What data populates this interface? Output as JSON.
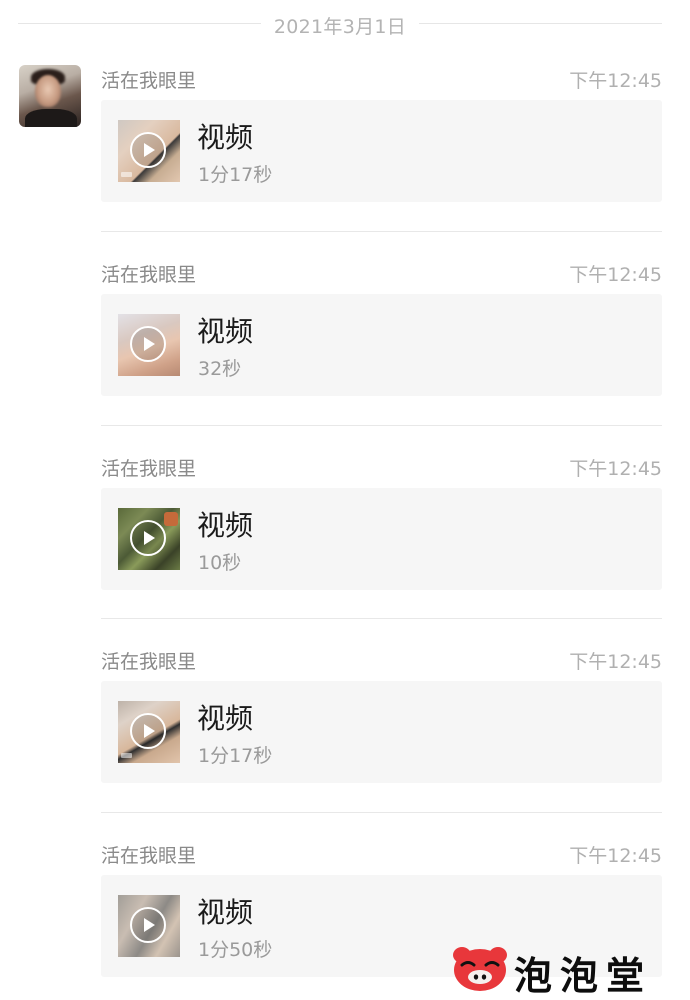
{
  "date_separator": "2021年3月1日",
  "colors": {
    "card_bg": "#f6f6f6",
    "muted_text": "#9a9a9a",
    "primary_text": "#1a1a1a",
    "watermark_red": "#e8373b"
  },
  "messages": [
    {
      "sender": "活在我眼里",
      "time": "下午12:45",
      "type_label": "视频",
      "duration": "1分17秒",
      "thumbnail": "video-thumbnail-1"
    },
    {
      "sender": "活在我眼里",
      "time": "下午12:45",
      "type_label": "视频",
      "duration": "32秒",
      "thumbnail": "video-thumbnail-2"
    },
    {
      "sender": "活在我眼里",
      "time": "下午12:45",
      "type_label": "视频",
      "duration": "10秒",
      "thumbnail": "video-thumbnail-3"
    },
    {
      "sender": "活在我眼里",
      "time": "下午12:45",
      "type_label": "视频",
      "duration": "1分17秒",
      "thumbnail": "video-thumbnail-4"
    },
    {
      "sender": "活在我眼里",
      "time": "下午12:45",
      "type_label": "视频",
      "duration": "1分50秒",
      "thumbnail": "video-thumbnail-5"
    }
  ],
  "watermark": {
    "text": "泡泡堂",
    "icon": "pig-mascot-icon"
  }
}
